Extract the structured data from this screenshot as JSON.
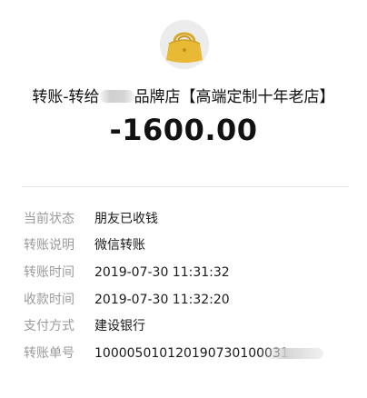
{
  "header": {
    "avatar_icon": "yellow-handbag-icon",
    "merchant_title_prefix": "转账-转给",
    "merchant_title_suffix": "品牌店【高端定制十年老店】",
    "amount": "-1600.00"
  },
  "details": [
    {
      "label": "当前状态",
      "value": "朋友已收钱"
    },
    {
      "label": "转账说明",
      "value": "微信转账"
    },
    {
      "label": "转账时间",
      "value": "2019-07-30 11:31:32"
    },
    {
      "label": "收款时间",
      "value": "2019-07-30 11:32:20"
    },
    {
      "label": "支付方式",
      "value": "建设银行"
    },
    {
      "label": "转账单号",
      "value": "100005010120190730100031"
    }
  ],
  "colors": {
    "label_gray": "#9a9a9a",
    "text_dark": "#1a1a1a",
    "bag_yellow": "#e7b935"
  }
}
